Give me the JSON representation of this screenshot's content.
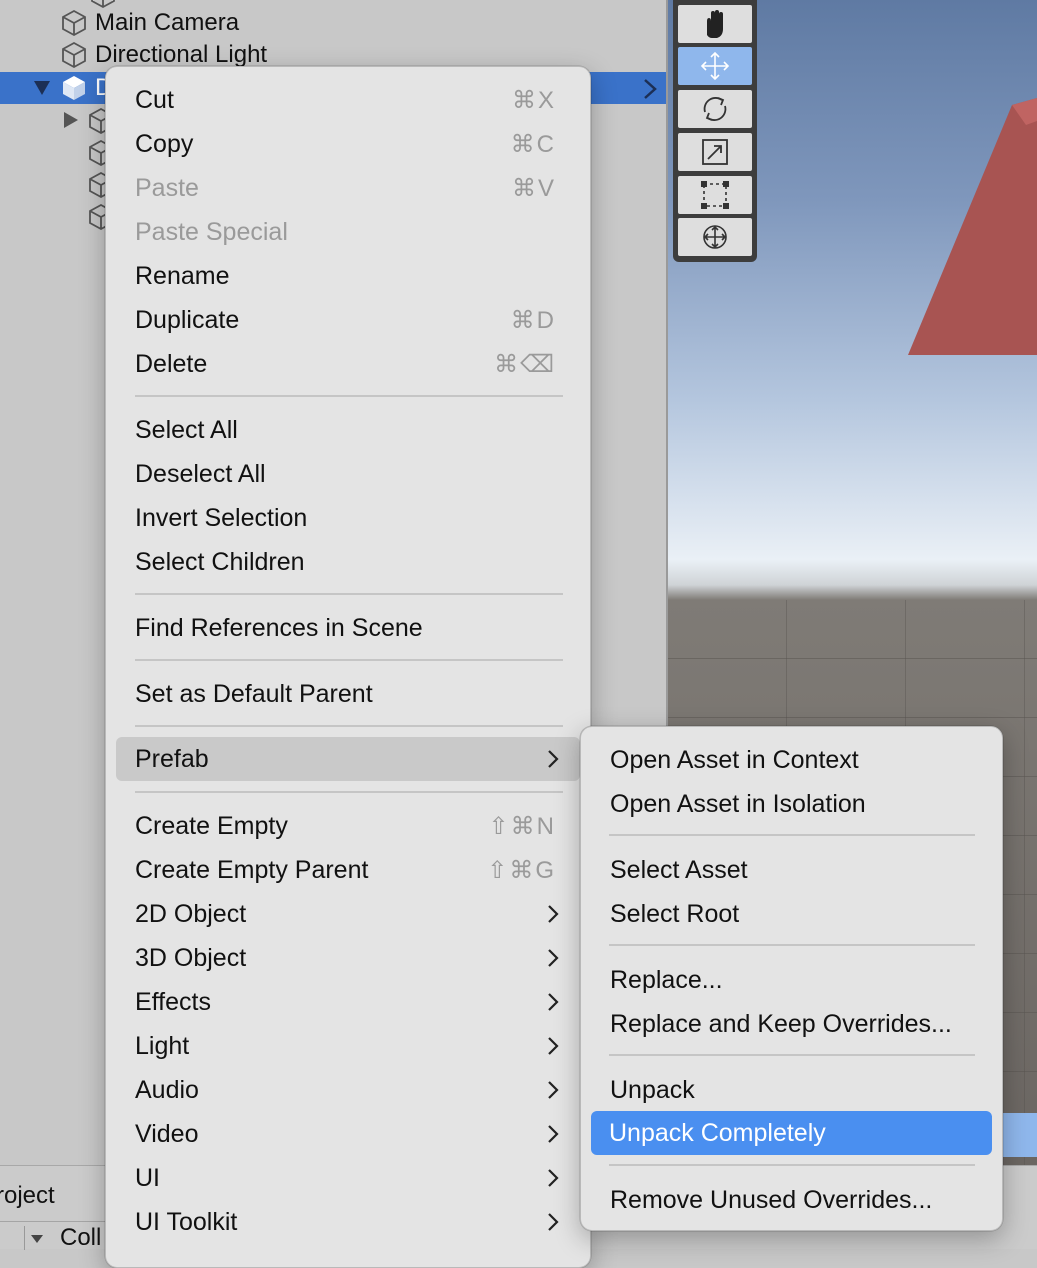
{
  "hierarchy": {
    "rows": [
      {
        "label": "Main Camera"
      },
      {
        "label": "Directional Light"
      },
      {
        "label": "D"
      }
    ]
  },
  "bottom": {
    "project_tab": "roject",
    "collapse_label": "Coll"
  },
  "scene_toolbar": {
    "tools": [
      "hand-icon",
      "move-icon",
      "rotate-icon",
      "scale-icon",
      "rect-icon",
      "transform-icon"
    ],
    "active_tool": "move-icon"
  },
  "context_menu": {
    "group1": [
      {
        "label": "Cut",
        "shortcut": "⌘X",
        "enabled": true
      },
      {
        "label": "Copy",
        "shortcut": "⌘C",
        "enabled": true
      },
      {
        "label": "Paste",
        "shortcut": "⌘V",
        "enabled": false
      },
      {
        "label": "Paste Special",
        "shortcut": "",
        "enabled": false
      },
      {
        "label": "Rename",
        "shortcut": "",
        "enabled": true
      },
      {
        "label": "Duplicate",
        "shortcut": "⌘D",
        "enabled": true
      },
      {
        "label": "Delete",
        "shortcut": "⌘⌫",
        "enabled": true
      }
    ],
    "group2": [
      {
        "label": "Select All"
      },
      {
        "label": "Deselect All"
      },
      {
        "label": "Invert Selection"
      },
      {
        "label": "Select Children"
      }
    ],
    "find_references": "Find References in Scene",
    "set_default_parent": "Set as Default Parent",
    "prefab": "Prefab",
    "group5": [
      {
        "label": "Create Empty",
        "shortcut": "⇧⌘N"
      },
      {
        "label": "Create Empty Parent",
        "shortcut": "⇧⌘G"
      },
      {
        "label": "2D Object",
        "submenu": true
      },
      {
        "label": "3D Object",
        "submenu": true
      },
      {
        "label": "Effects",
        "submenu": true
      },
      {
        "label": "Light",
        "submenu": true
      },
      {
        "label": "Audio",
        "submenu": true
      },
      {
        "label": "Video",
        "submenu": true
      },
      {
        "label": "UI",
        "submenu": true
      },
      {
        "label": "UI Toolkit",
        "submenu": true
      }
    ]
  },
  "prefab_submenu": {
    "open_in_context": "Open Asset in Context",
    "open_in_isolation": "Open Asset in Isolation",
    "select_asset": "Select Asset",
    "select_root": "Select Root",
    "replace": "Replace...",
    "replace_keep": "Replace and Keep Overrides...",
    "unpack": "Unpack",
    "unpack_completely": "Unpack Completely",
    "remove_unused": "Remove Unused Overrides..."
  },
  "colors": {
    "selection_blue": "#4a8ff0",
    "hierarchy_selected": "#3a72c9",
    "active_tool": "#8fb7ec",
    "cube_red": "#a85452"
  }
}
